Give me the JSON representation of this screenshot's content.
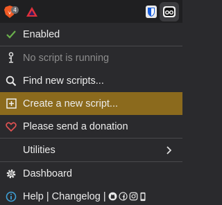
{
  "toolbar": {
    "badge_count": "4",
    "brave_icon": "brave-lion-icon",
    "triangle_icon": "triangle-extension-icon",
    "bitwarden_icon": "bitwarden-shield-icon",
    "violentmonkey_icon": "violentmonkey-icon"
  },
  "menu": {
    "enabled": "Enabled",
    "no_script": "No script is running",
    "find_scripts": "Find new scripts...",
    "create_script": "Create a new script...",
    "donation": "Please send a donation",
    "utilities": "Utilities",
    "dashboard": "Dashboard",
    "help": "Help",
    "changelog": "Changelog"
  },
  "colors": {
    "accent": "#8b6a1d",
    "check": "#6ab04c",
    "heart": "#e05252",
    "info": "#3ea0d6"
  }
}
